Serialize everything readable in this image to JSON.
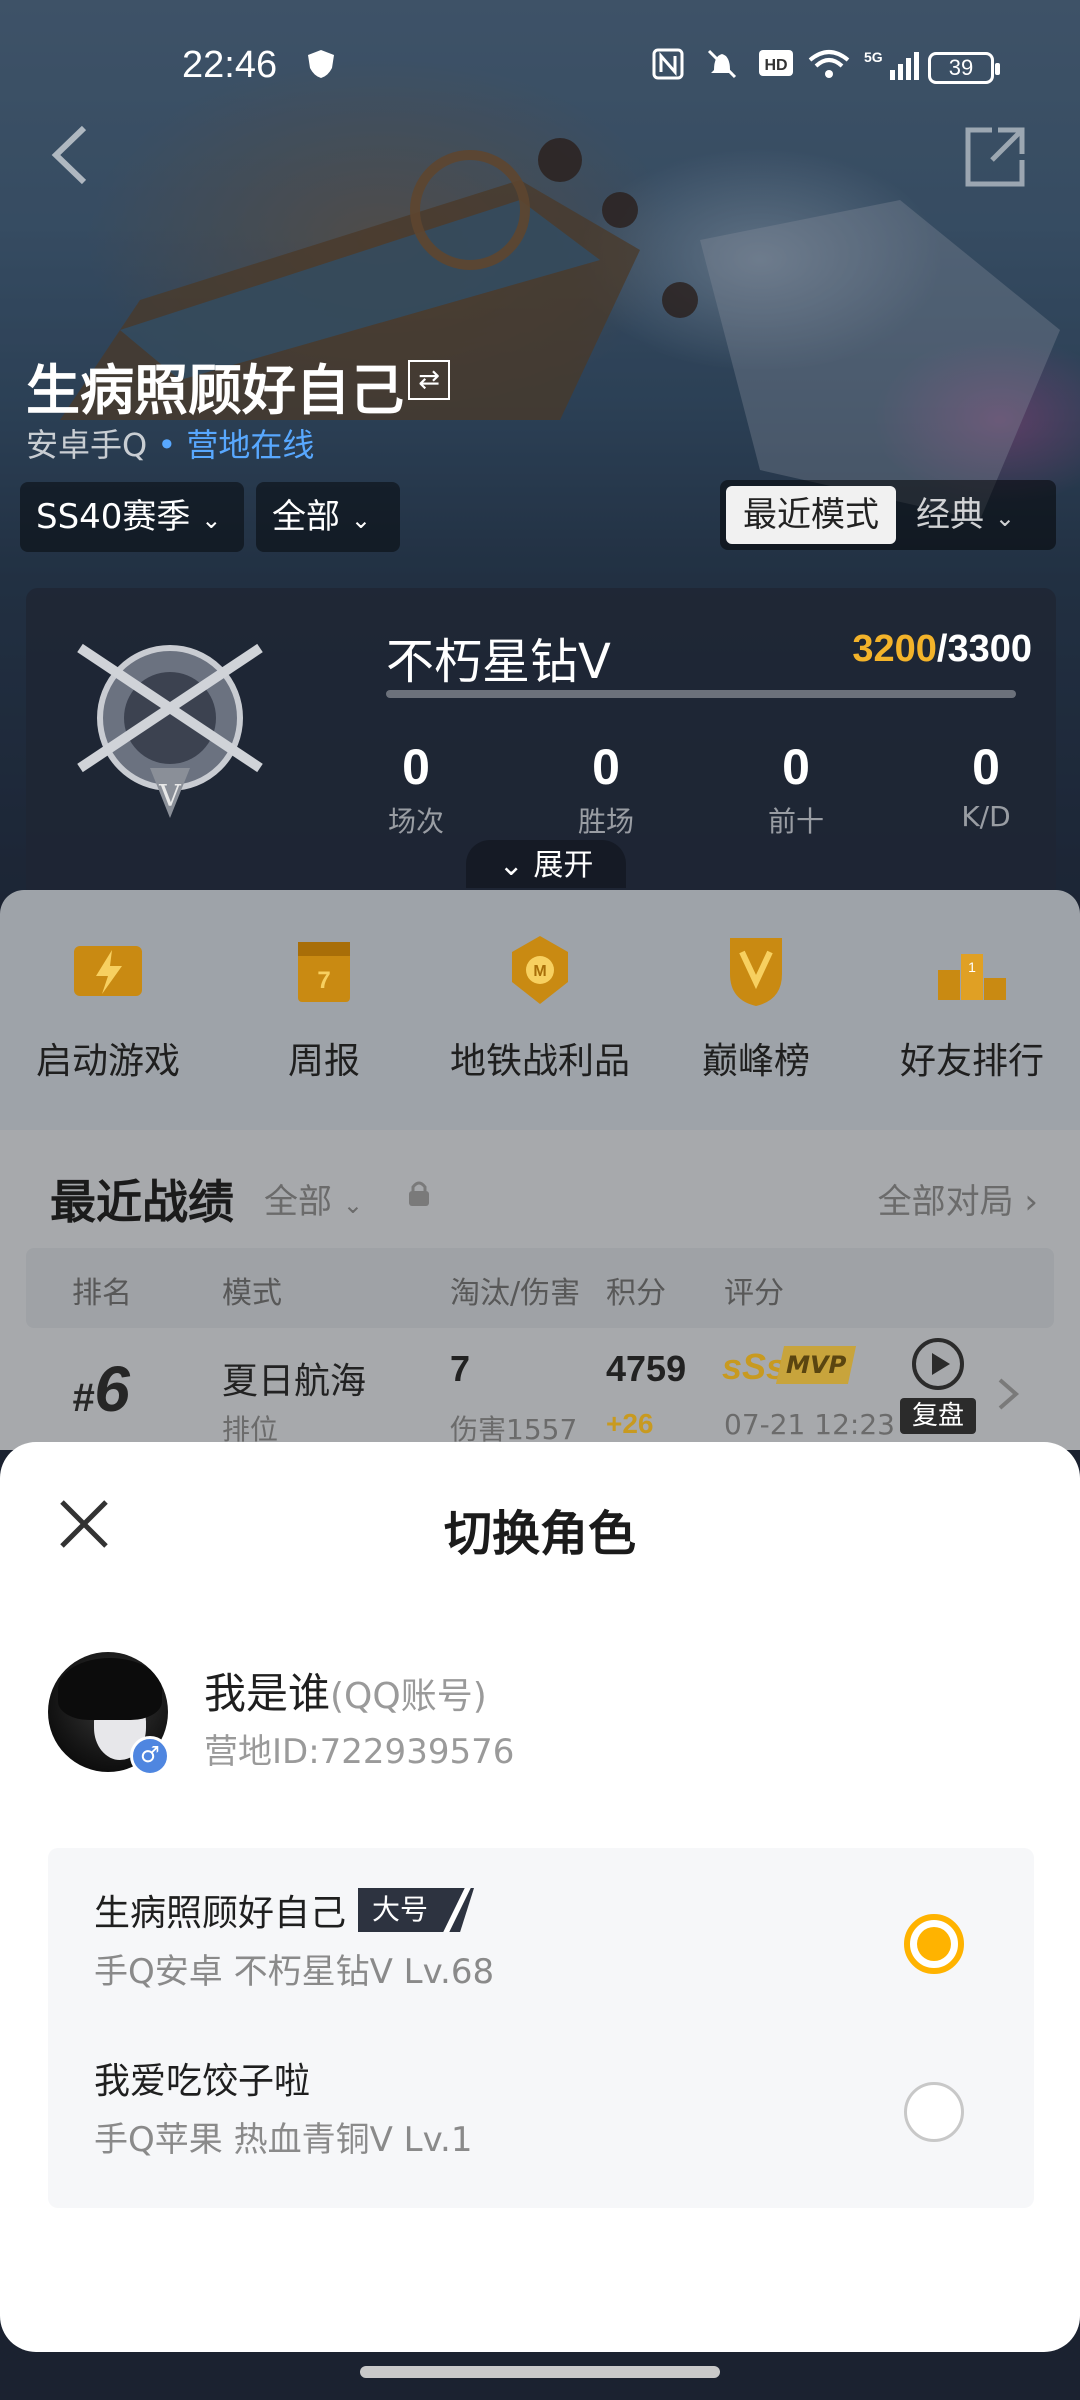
{
  "status_bar": {
    "time": "22:46",
    "battery": "39",
    "icons": [
      "shield-icon",
      "nfc-icon",
      "mute-icon",
      "hd-icon",
      "wifi-icon",
      "5g-signal-icon",
      "battery-icon"
    ]
  },
  "header": {
    "player_name": "生病照顾好自己",
    "swap_icon": "⇄",
    "platform": "安卓手Q",
    "online_status": "营地在线",
    "season_chip": "SS40赛季",
    "filter_chip": "全部",
    "mode_active": "最近模式",
    "mode_other": "经典"
  },
  "rank_card": {
    "rank_name": "不朽星钻V",
    "score_current": "3200",
    "score_total": "/3300",
    "stats": [
      {
        "value": "0",
        "label": "场次"
      },
      {
        "value": "0",
        "label": "胜场"
      },
      {
        "value": "0",
        "label": "前十"
      },
      {
        "value": "0",
        "label": "K/D"
      }
    ],
    "expand_label": "展开"
  },
  "shortcuts": [
    {
      "label": "启动游戏",
      "icon": "launch-game-icon"
    },
    {
      "label": "周报",
      "icon": "weekly-report-icon"
    },
    {
      "label": "地铁战利品",
      "icon": "metro-loot-icon"
    },
    {
      "label": "巅峰榜",
      "icon": "peak-ranking-icon"
    },
    {
      "label": "好友排行",
      "icon": "friend-ranking-icon"
    }
  ],
  "recent": {
    "title": "最近战绩",
    "filter": "全部",
    "all_matches": "全部对局",
    "columns": [
      "排名",
      "模式",
      "淘汰/伤害",
      "积分",
      "评分"
    ],
    "row": {
      "rank": "6",
      "mode": "夏日航海",
      "mode_sub": "排位",
      "kills": "7",
      "damage": "伤害1557",
      "points": "4759",
      "points_delta": "+26",
      "rating": "sSs",
      "mvp": "MVP",
      "date": "07-21 12:23",
      "replay": "复盘"
    }
  },
  "sheet": {
    "title": "切换角色",
    "account_name": "我是谁",
    "account_tag": "(QQ账号)",
    "account_id": "营地ID:722939576",
    "gender_symbol": "♂",
    "roles": [
      {
        "name": "生病照顾好自己",
        "tag": "大号",
        "sub": "手Q安卓  不朽星钻V  Lv.68",
        "selected": true
      },
      {
        "name": "我爱吃饺子啦",
        "tag": "",
        "sub": "手Q苹果  热血青铜V  Lv.1",
        "selected": false
      }
    ]
  },
  "colors": {
    "accent": "#ffb300",
    "online": "#58a8ff",
    "score_gold": "#f3b32a"
  }
}
